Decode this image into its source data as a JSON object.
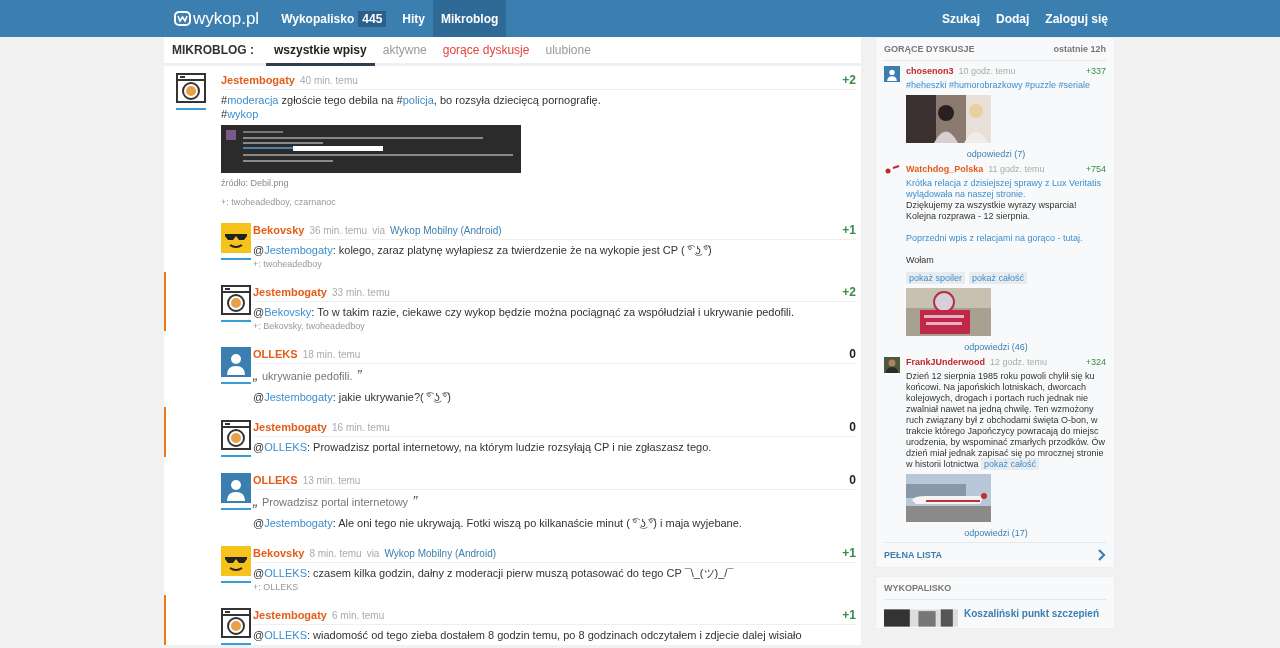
{
  "header": {
    "logo": "wykop.pl",
    "nav": [
      {
        "label": "Wykopalisko",
        "count": "445",
        "selected": false
      },
      {
        "label": "Hity",
        "selected": false
      },
      {
        "label": "Mikroblog",
        "selected": true
      }
    ],
    "actions": [
      "Szukaj",
      "Dodaj",
      "Zaloguj się"
    ]
  },
  "subnav": {
    "label": "MIKROBLOG :",
    "tabs": [
      {
        "label": "wszystkie wpisy",
        "selected": true,
        "hot": false
      },
      {
        "label": "aktywne",
        "selected": false,
        "hot": false
      },
      {
        "label": "gorące dyskusje",
        "selected": false,
        "hot": true
      },
      {
        "label": "ulubione",
        "selected": false,
        "hot": false
      }
    ]
  },
  "entries": [
    {
      "kind": "op",
      "avatar": {
        "kind": "washer"
      },
      "author": "Jestembogaty",
      "color": "#e35c17",
      "time": "40 min. temu",
      "score": "+2",
      "score_positive": true,
      "highlighted": false,
      "body": [
        {
          "kind": "text",
          "parts": [
            {
              "kind": "plain",
              "text": "#"
            },
            {
              "kind": "link",
              "text": "moderacja"
            },
            {
              "kind": "plain",
              "text": " zgłoście tego debila na #"
            },
            {
              "kind": "link",
              "text": "policja"
            },
            {
              "kind": "plain",
              "text": ", bo rozsyła dziecięcą pornografię."
            }
          ]
        },
        {
          "kind": "text",
          "parts": [
            {
              "kind": "plain",
              "text": "#"
            },
            {
              "kind": "link",
              "text": "wykop"
            }
          ]
        }
      ],
      "attachment": {
        "kind": "picture",
        "source": "źródło: Debil.png"
      },
      "plus": "+: twoheadedboy, czarnanoc"
    },
    {
      "kind": "reply",
      "avatar": {
        "kind": "shades"
      },
      "author": "Bekovsky",
      "color": "#e35c17",
      "time": "36 min. temu",
      "via": "via",
      "app": "Wykop Mobilny (Android)",
      "score": "+1",
      "score_positive": true,
      "highlighted": false,
      "body": [
        {
          "kind": "text",
          "parts": [
            {
              "kind": "plain",
              "text": "@"
            },
            {
              "kind": "link",
              "text": "Jestembogaty"
            },
            {
              "kind": "plain",
              "text": ": kolego, zaraz platynę wyłapiesz za twierdzenie że na wykopie jest CP ( ͡° ͜ʖ ͡°)"
            }
          ]
        }
      ],
      "plus": "+: twoheadedboy"
    },
    {
      "kind": "reply",
      "avatar": {
        "kind": "washer"
      },
      "author": "Jestembogaty",
      "color": "#e35c17",
      "time": "33 min. temu",
      "score": "+2",
      "score_positive": true,
      "highlighted": true,
      "body": [
        {
          "kind": "text",
          "parts": [
            {
              "kind": "plain",
              "text": "@"
            },
            {
              "kind": "link",
              "text": "Bekovsky"
            },
            {
              "kind": "plain",
              "text": ": To w takim razie, ciekawe czy wykop będzie można pociągnąć za współudział i ukrywanie pedofili."
            }
          ]
        }
      ],
      "plus": "+: Bekovsky, twoheadedboy"
    },
    {
      "kind": "reply",
      "avatar": {
        "kind": "person"
      },
      "author": "OLLEKS",
      "color": "#e35c17",
      "time": "18 min. temu",
      "score": "0",
      "score_positive": false,
      "highlighted": false,
      "body": [
        {
          "kind": "quote",
          "open": "„",
          "text": "ukrywanie pedofili.",
          "close": "”"
        },
        {
          "kind": "text",
          "parts": [
            {
              "kind": "plain",
              "text": "@"
            },
            {
              "kind": "link",
              "text": "Jestembogaty"
            },
            {
              "kind": "plain",
              "text": ": jakie ukrywanie?( ͡° ͜ʖ ͡°)"
            }
          ]
        }
      ]
    },
    {
      "kind": "reply",
      "avatar": {
        "kind": "washer"
      },
      "author": "Jestembogaty",
      "color": "#e35c17",
      "time": "16 min. temu",
      "score": "0",
      "score_positive": false,
      "highlighted": true,
      "body": [
        {
          "kind": "text",
          "parts": [
            {
              "kind": "plain",
              "text": "@"
            },
            {
              "kind": "link",
              "text": "OLLEKS"
            },
            {
              "kind": "plain",
              "text": ": Prowadzisz portal internetowy, na którym ludzie rozsyłają CP i nie zgłaszasz tego."
            }
          ]
        }
      ]
    },
    {
      "kind": "reply",
      "avatar": {
        "kind": "person"
      },
      "author": "OLLEKS",
      "color": "#e35c17",
      "time": "13 min. temu",
      "score": "0",
      "score_positive": false,
      "highlighted": false,
      "body": [
        {
          "kind": "quote",
          "open": "„",
          "text": "Prowadzisz portal internetowy",
          "close": "”"
        },
        {
          "kind": "text",
          "parts": [
            {
              "kind": "plain",
              "text": "@"
            },
            {
              "kind": "link",
              "text": "Jestembogaty"
            },
            {
              "kind": "plain",
              "text": ": Ale oni tego nie ukrywają. Fotki wiszą po kilkanaście minut ( ͡° ͜ʖ ͡°) i maja wyjebane."
            }
          ]
        }
      ]
    },
    {
      "kind": "reply",
      "avatar": {
        "kind": "shades"
      },
      "author": "Bekovsky",
      "color": "#e35c17",
      "time": "8 min. temu",
      "via": "via",
      "app": "Wykop Mobilny (Android)",
      "score": "+1",
      "score_positive": true,
      "highlighted": false,
      "body": [
        {
          "kind": "text",
          "parts": [
            {
              "kind": "plain",
              "text": "@"
            },
            {
              "kind": "link",
              "text": "OLLEKS"
            },
            {
              "kind": "plain",
              "text": ": czasem kilka godzin, dałny z moderacji pierw muszą potasować do tego CP ¯\\_(ツ)_/¯"
            }
          ]
        }
      ],
      "plus": "+: OLLEKS"
    },
    {
      "kind": "reply",
      "avatar": {
        "kind": "washer"
      },
      "author": "Jestembogaty",
      "color": "#e35c17",
      "time": "6 min. temu",
      "score": "+1",
      "score_positive": true,
      "highlighted": true,
      "body": [
        {
          "kind": "text",
          "parts": [
            {
              "kind": "plain",
              "text": "@"
            },
            {
              "kind": "link",
              "text": "OLLEKS"
            },
            {
              "kind": "plain",
              "text": ": wiadomość od tego zieba dostałem 8 godzin temu, po 8 godzinach odczytałem i zdjecie dalej wisiało"
            }
          ]
        }
      ]
    }
  ],
  "sidebar": {
    "hot": {
      "title": "GORĄCE DYSKUSJE",
      "period": "ostatnie 12h",
      "items": [
        {
          "avatar": {
            "kind": "person"
          },
          "author": "chosenon3",
          "color": "#c0282d",
          "time": "10 godz. temu",
          "score": "+337",
          "body": [
            {
              "kind": "link",
              "text": "#heheszki #humorobrazkowy #puzzle #seriale"
            }
          ],
          "picture": {
            "kind": "people"
          },
          "replies": "odpowiedzi (7)"
        },
        {
          "avatar": {
            "kind": "mark"
          },
          "author": "Watchdog_Polska",
          "color": "#e35c17",
          "time": "11 godz. temu",
          "score": "+754",
          "body": [
            {
              "kind": "link",
              "text": "Krótka relacja z dzisiejszej sprawy z Lux Veritatis wylądowała na naszej stronie."
            },
            {
              "kind": "text",
              "parts": [
                {
                  "kind": "plain",
                  "text": "Dziękujemy za wszystkie wyrazy wsparcia! Kolejna rozprawa - 12 sierpnia."
                }
              ]
            },
            {
              "kind": "gap"
            },
            {
              "kind": "link",
              "text": "Poprzedni wpis z relacjami na gorąco - tutaj."
            },
            {
              "kind": "gap"
            },
            {
              "kind": "text",
              "parts": [
                {
                  "kind": "plain",
                  "text": "Wołam"
                }
              ]
            }
          ],
          "buttons": [
            "pokaż spoiler",
            "pokaż całość"
          ],
          "picture": {
            "kind": "sign"
          },
          "replies": "odpowiedzi (46)"
        },
        {
          "avatar": {
            "kind": "portrait"
          },
          "author": "FrankJUnderwood",
          "color": "#c0282d",
          "time": "12 godz. temu",
          "score": "+324",
          "body": [
            {
              "kind": "text",
              "parts": [
                {
                  "kind": "plain",
                  "text": "Dzień 12 sierpnia 1985 roku powoli chylił się ku końcowi. Na japońskich lotniskach, dworcach kolejowych, drogach i portach ruch jednak nie zwalniał nawet na jedną chwilę. Ten wzmożony ruch związany był z obchodami święta O-bon, w trakcie którego Japończycy powracają do miejsc urodzenia, by wspominać zmarłych przodków. Ów dzień miał jednak zapisać się po mrocznej stronie w historii lotnictwa "
                }
              ]
            }
          ],
          "inline_button": "pokaż całość",
          "picture": {
            "kind": "plane"
          },
          "replies": "odpowiedzi (17)"
        }
      ],
      "more": "PEŁNA LISTA"
    },
    "digs": {
      "title": "WYKOPALISKO",
      "item": "Koszaliński punkt szczepień"
    }
  }
}
